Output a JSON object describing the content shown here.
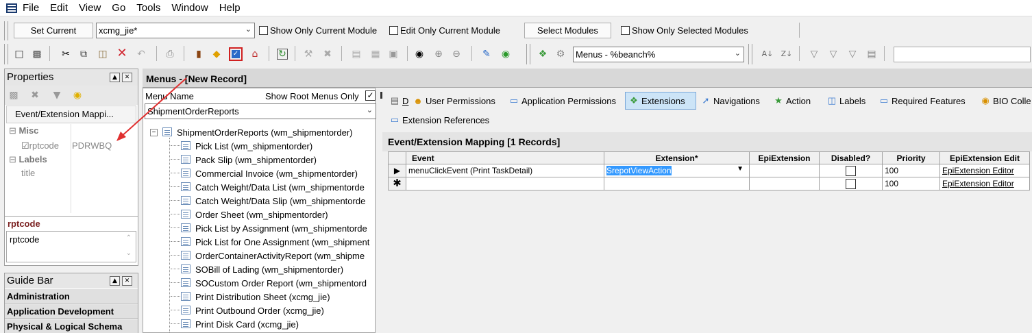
{
  "menubar": {
    "items": [
      "File",
      "Edit",
      "View",
      "Go",
      "Tools",
      "Window",
      "Help"
    ]
  },
  "toolbar1": {
    "set_current": "Set Current",
    "module_value": "xcmg_jie*",
    "show_only_current_module": "Show Only Current Module",
    "edit_only_current_module": "Edit Only Current Module",
    "select_modules": "Select Modules",
    "show_only_selected_modules": "Show Only Selected Modules"
  },
  "toolbar2": {
    "menu_filter_value": "Menus - %beanch%",
    "icons": [
      "new-icon",
      "save-icon",
      "cut-icon",
      "copy-icon",
      "paste-icon",
      "delete-icon",
      "undo-icon",
      "print-icon",
      "book-icon",
      "diamond-icon",
      "check-icon",
      "home-icon",
      "refresh-icon",
      "hammer-icon",
      "tools-x-icon",
      "grid1-icon",
      "grid2-icon",
      "image-icon",
      "binoculars-icon",
      "zoom-in-icon",
      "zoom-out-icon",
      "edit-doc-icon",
      "glasses-icon",
      "puzzle-icon",
      "gear-icon",
      "sort-asc-icon",
      "sort-desc-icon",
      "filter1-icon",
      "filter2-icon",
      "filter3-icon",
      "filter4-icon"
    ]
  },
  "properties": {
    "title": "Properties",
    "object_label": "Event/Extension Mappi...",
    "misc_header": "Misc",
    "rptcode_label": "rptcode",
    "rptcode_value": "PDRWBQ",
    "labels_header": "Labels",
    "title_label": "title",
    "desc_title": "rptcode",
    "desc_text": "rptcode"
  },
  "guide_bar": {
    "title": "Guide Bar",
    "items": [
      "Administration",
      "Application Development",
      "Physical & Logical Schema"
    ]
  },
  "menus_panel": {
    "title": "Menus - [New Record]",
    "menu_name_label": "Menu Name",
    "show_root_menus_only": "Show Root Menus Only",
    "menu_value": "ShipmentOrderReports",
    "root": "ShipmentOrderReports  (wm_shipmentorder)",
    "children": [
      "Pick List  (wm_shipmentorder)",
      "Pack Slip  (wm_shipmentorder)",
      "Commercial Invoice  (wm_shipmentorder)",
      "Catch Weight/Data List  (wm_shipmentorde",
      "Catch Weight/Data Slip  (wm_shipmentorde",
      "Order Sheet  (wm_shipmentorder)",
      "Pick List by Assignment  (wm_shipmentorde",
      "Pick List for One Assignment  (wm_shipment",
      "OrderContainerActivityReport  (wm_shipme",
      "SOBill of Lading  (wm_shipmentorder)",
      "SOCustom Order Report  (wm_shipmentord",
      "Print Distribution Sheet  (xcmg_jie)",
      "Print Outbound Order  (xcmg_jie)",
      "Print Disk Card  (xcmg_jie)"
    ]
  },
  "tabs": [
    {
      "label": "D",
      "icon": "form-icon"
    },
    {
      "label": "User Permissions",
      "icon": "users-icon"
    },
    {
      "label": "Application Permissions",
      "icon": "app-icon"
    },
    {
      "label": "Extensions",
      "icon": "extensions-icon"
    },
    {
      "label": "Navigations",
      "icon": "navigation-icon"
    },
    {
      "label": "Action",
      "icon": "action-icon"
    },
    {
      "label": "Labels",
      "icon": "labels-icon"
    },
    {
      "label": "Required Features",
      "icon": "features-icon"
    },
    {
      "label": "BIO Colle",
      "icon": "bio-icon"
    },
    {
      "label": "Extension References",
      "icon": "references-icon"
    }
  ],
  "grid": {
    "title": "Event/Extension Mapping [1 Records]",
    "columns": [
      "Event",
      "Extension*",
      "EpiExtension",
      "Disabled?",
      "Priority",
      "EpiExtension Edit"
    ],
    "rows": [
      {
        "event": "menuClickEvent (Print TaskDetail)",
        "extension": "SrepotViewAction",
        "epi": "",
        "priority": "100",
        "editor": "EpiExtension Editor"
      },
      {
        "event": "",
        "extension": "",
        "epi": "",
        "priority": "100",
        "editor": "EpiExtension Editor"
      }
    ]
  },
  "colors": {
    "annotation_red": "#e03030",
    "selection_blue": "#3399ff",
    "active_tab": "#cce4f7"
  }
}
